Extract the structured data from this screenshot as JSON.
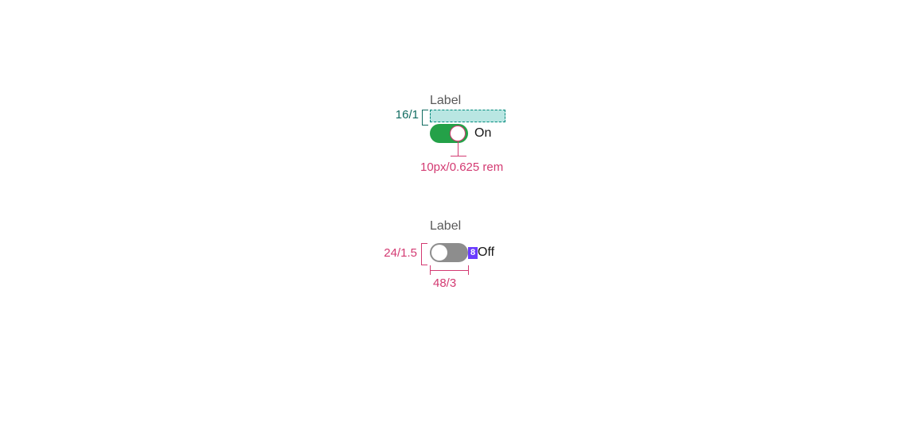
{
  "spec": {
    "toggle_on": {
      "label": "Label",
      "state_text": "On",
      "label_gap_annotation": "16/1",
      "thumb_radius_annotation": "10px/0.625 rem"
    },
    "toggle_off": {
      "label": "Label",
      "state_text": "Off",
      "height_annotation": "24/1.5",
      "width_annotation": "48/3",
      "state_gap_annotation": "8"
    }
  },
  "colors": {
    "dim_teal": "#116c61",
    "dim_pink": "#d33a72",
    "dim_purple": "#6a3cff",
    "toggle_on": "#24a148",
    "toggle_off": "#8d8d8d",
    "text_muted": "#595959",
    "text": "#161616",
    "gap_fill": "#b9e6e2"
  }
}
